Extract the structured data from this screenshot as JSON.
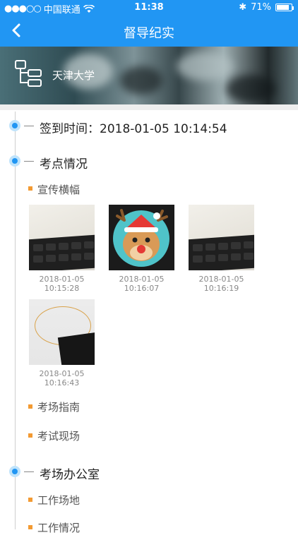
{
  "status_bar": {
    "signal": "●●●○○",
    "carrier": "中国联通",
    "time": "11:38",
    "bluetooth": "✱",
    "battery": "71%"
  },
  "nav": {
    "title": "督导纪实"
  },
  "banner": {
    "school": "天津大学"
  },
  "timeline": {
    "checkin": "签到时间：2018-01-05 10:14:54",
    "exam_site": {
      "title": "考点情况",
      "banner_label": "宣传横幅",
      "photos": [
        {
          "date": "2018-01-05",
          "time": "10:15:28"
        },
        {
          "date": "2018-01-05",
          "time": "10:16:07"
        },
        {
          "date": "2018-01-05",
          "time": "10:16:19"
        },
        {
          "date": "2018-01-05",
          "time": "10:16:43"
        }
      ],
      "guide_label": "考场指南",
      "scene_label": "考试现场"
    },
    "office": {
      "title": "考场办公室",
      "workplace_label": "工作场地",
      "work_status_label": "工作情况"
    }
  },
  "colors": {
    "accent": "#2196f3",
    "bullet": "#f39a32"
  }
}
